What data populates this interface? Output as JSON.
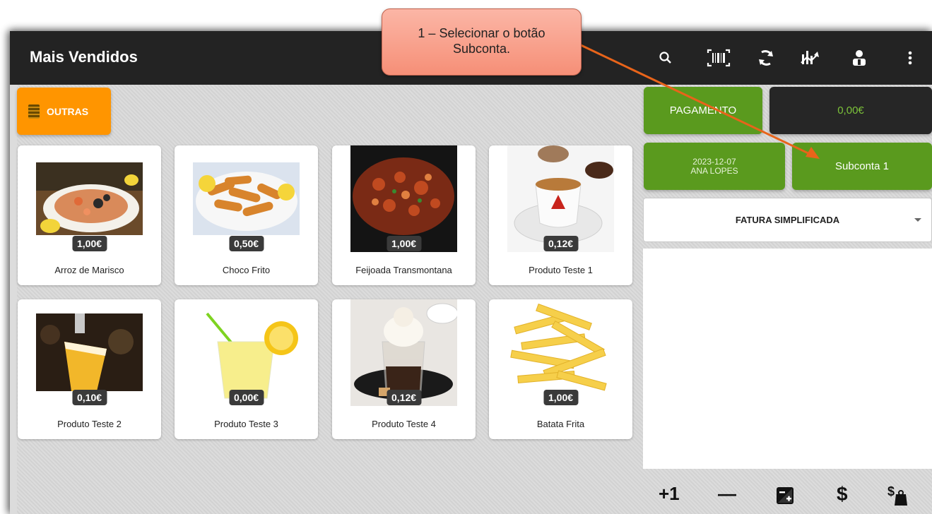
{
  "header": {
    "title": "Mais Vendidos",
    "icons": [
      "search-icon",
      "barcode-icon",
      "sync-icon",
      "chart-icon",
      "user-icon",
      "more-vert-icon"
    ]
  },
  "category": {
    "label": "OUTRAS",
    "color": "#ff9500"
  },
  "products": [
    {
      "name": "Arroz de Marisco",
      "price": "1,00€"
    },
    {
      "name": "Choco Frito",
      "price": "0,50€"
    },
    {
      "name": "Feijoada Transmontana",
      "price": "1,00€"
    },
    {
      "name": "Produto Teste 1",
      "price": "0,12€"
    },
    {
      "name": "Produto Teste 2",
      "price": "0,10€"
    },
    {
      "name": "Produto Teste 3",
      "price": "0,00€"
    },
    {
      "name": "Produto Teste 4",
      "price": "0,12€"
    },
    {
      "name": "Batata Frita",
      "price": "1,00€"
    }
  ],
  "payment": {
    "label": "PAGAMENTO",
    "total": "0,00€"
  },
  "session": {
    "date": "2023-12-07",
    "operator": "ANA LOPES"
  },
  "subaccount": {
    "label": "Subconta 1"
  },
  "document_type": {
    "selected": "FATURA SIMPLIFICADA"
  },
  "bottom_actions": {
    "plus_one": "+1",
    "minus": "—",
    "dollar": "$"
  },
  "callout": {
    "line1": "1 – Selecionar o botão",
    "line2": "Subconta."
  },
  "colors": {
    "accent_green": "#5a9a1e",
    "topbar": "#232323",
    "callout": "#f68f77",
    "arrow": "#e8641a"
  }
}
